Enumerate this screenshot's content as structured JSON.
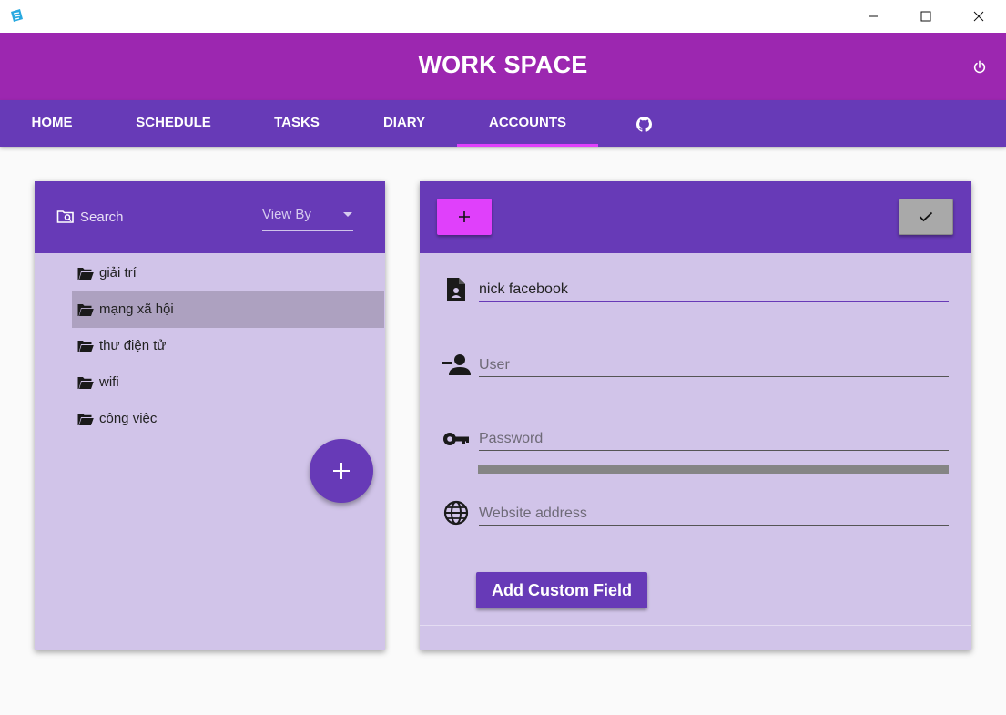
{
  "window": {
    "minimize_glyph": "—",
    "maximize_glyph": "☐",
    "close_glyph": "✕"
  },
  "header": {
    "title": "WORK SPACE"
  },
  "tabs": [
    {
      "label": "HOME"
    },
    {
      "label": "SCHEDULE"
    },
    {
      "label": "TASKS"
    },
    {
      "label": "DIARY"
    },
    {
      "label": "ACCOUNTS",
      "active": true
    }
  ],
  "left_panel": {
    "search_placeholder": "Search",
    "view_by_label": "View By",
    "folders": [
      {
        "label": "giải trí"
      },
      {
        "label": "mạng xã hội",
        "selected": true
      },
      {
        "label": "thư điện tử"
      },
      {
        "label": "wifi"
      },
      {
        "label": "công việc"
      }
    ]
  },
  "right_panel": {
    "add_symbol": "+",
    "save_symbol": "✓",
    "name_value": "nick facebook",
    "user_placeholder": "User",
    "password_placeholder": "Password",
    "website_placeholder": "Website address",
    "custom_field_label": "Add Custom Field"
  },
  "colors": {
    "header": "#9c27b0",
    "tabbar": "#673ab7",
    "accent": "#e040fb",
    "panel_bg": "#d1c4e9",
    "selected_row": "#ada1c0"
  },
  "icons": [
    "app-icon",
    "power-icon",
    "github-icon",
    "folder-search-icon",
    "dropdown-caret-icon",
    "folder-open-icon",
    "plus-icon",
    "check-icon",
    "file-account-icon",
    "account-minus-icon",
    "key-icon",
    "globe-icon"
  ]
}
